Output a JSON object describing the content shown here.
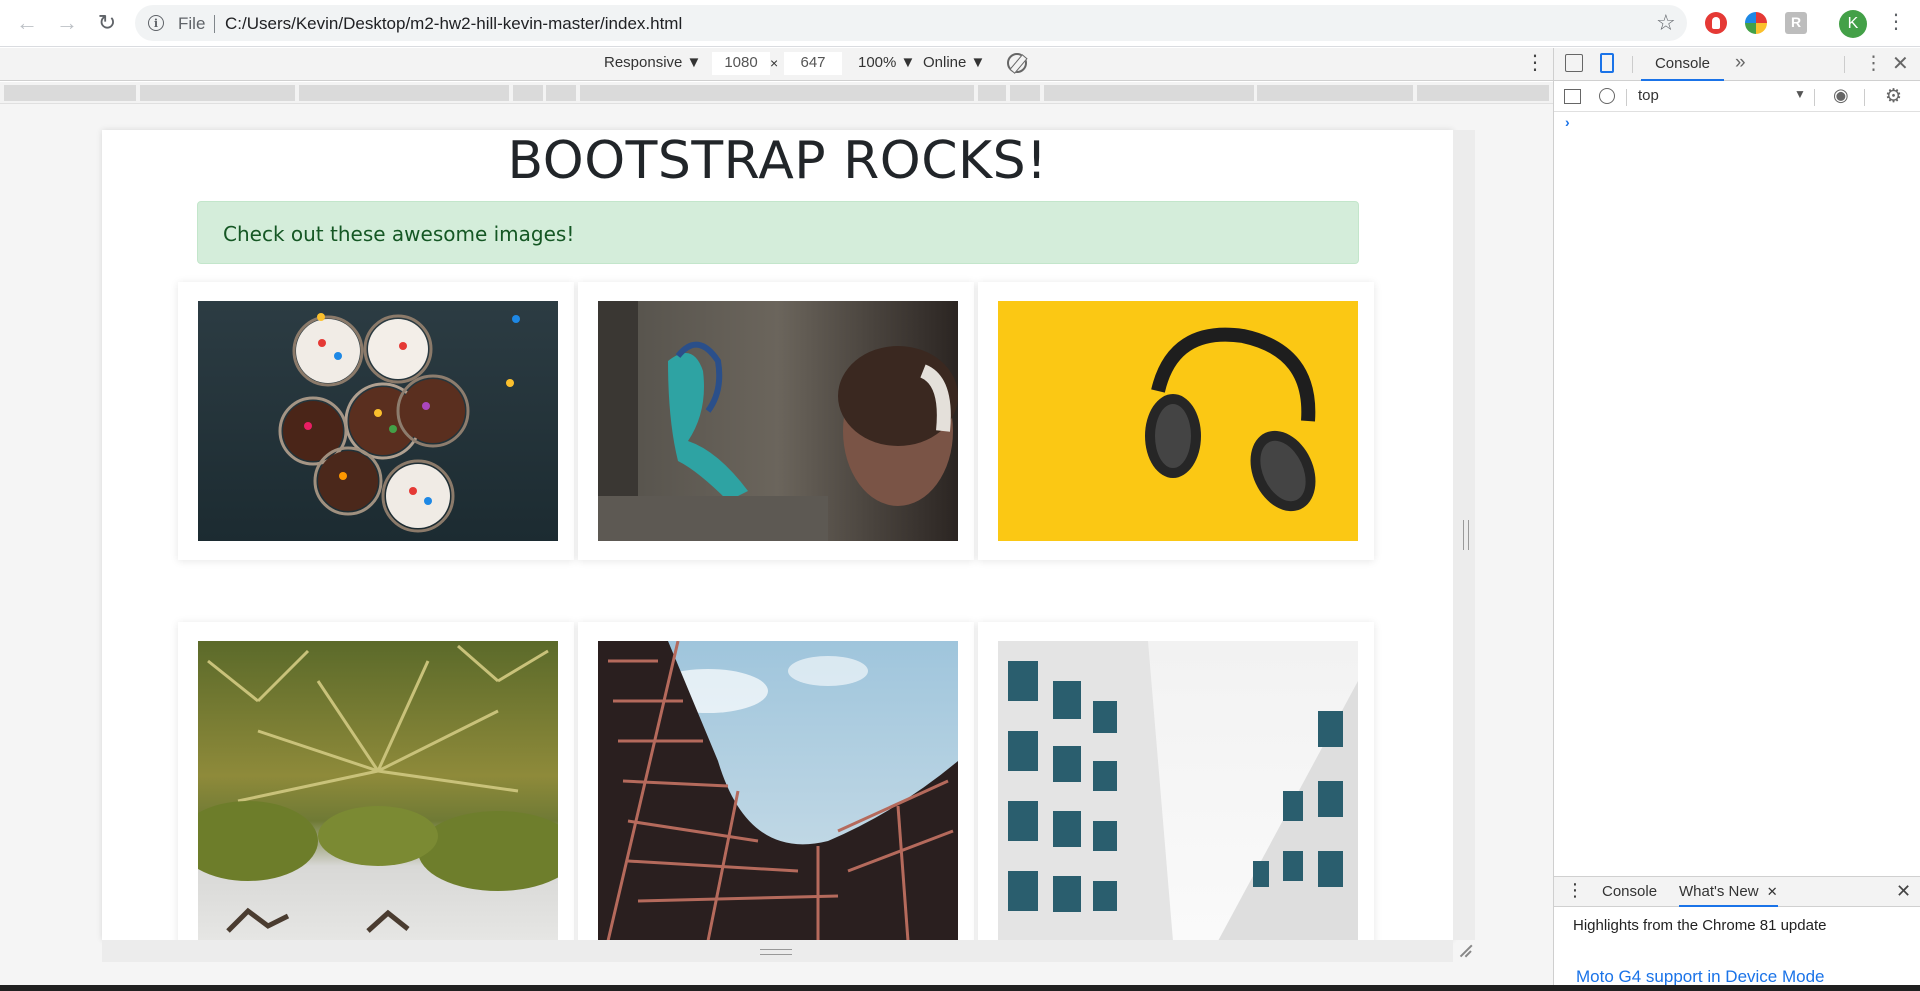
{
  "browser": {
    "url_scheme": "File",
    "url": "C:/Users/Kevin/Desktop/m2-hw2-hill-kevin-master/index.html",
    "profile_initial": "K"
  },
  "device_toolbar": {
    "device": "Responsive ▼",
    "width": "1080",
    "times": "×",
    "height": "647",
    "zoom": "100% ▼",
    "network": "Online ▼"
  },
  "page": {
    "title": "BOOTSTRAP ROCKS!",
    "alert_text": "Check out these awesome images!",
    "images": [
      {
        "name": "cupcakes"
      },
      {
        "name": "graffiti"
      },
      {
        "name": "headphones"
      },
      {
        "name": "palms"
      },
      {
        "name": "building1"
      },
      {
        "name": "building2"
      }
    ]
  },
  "devtools": {
    "tab": "Console",
    "more_tabs": "»",
    "context": "top",
    "drawer_tabs": [
      "Console",
      "What's New"
    ],
    "drawer_highlight": "Highlights from the Chrome 81 update",
    "drawer_link": "Moto G4 support in Device Mode"
  },
  "icons": [
    "back-arrow-icon",
    "forward-arrow-icon",
    "reload-icon",
    "info-icon",
    "star-icon",
    "kebab-menu-icon",
    "rotate-icon",
    "inspect-icon",
    "device-toggle-icon",
    "settings-icon",
    "eye-icon",
    "clear-icon",
    "sidebar-icon",
    "close-icon"
  ]
}
